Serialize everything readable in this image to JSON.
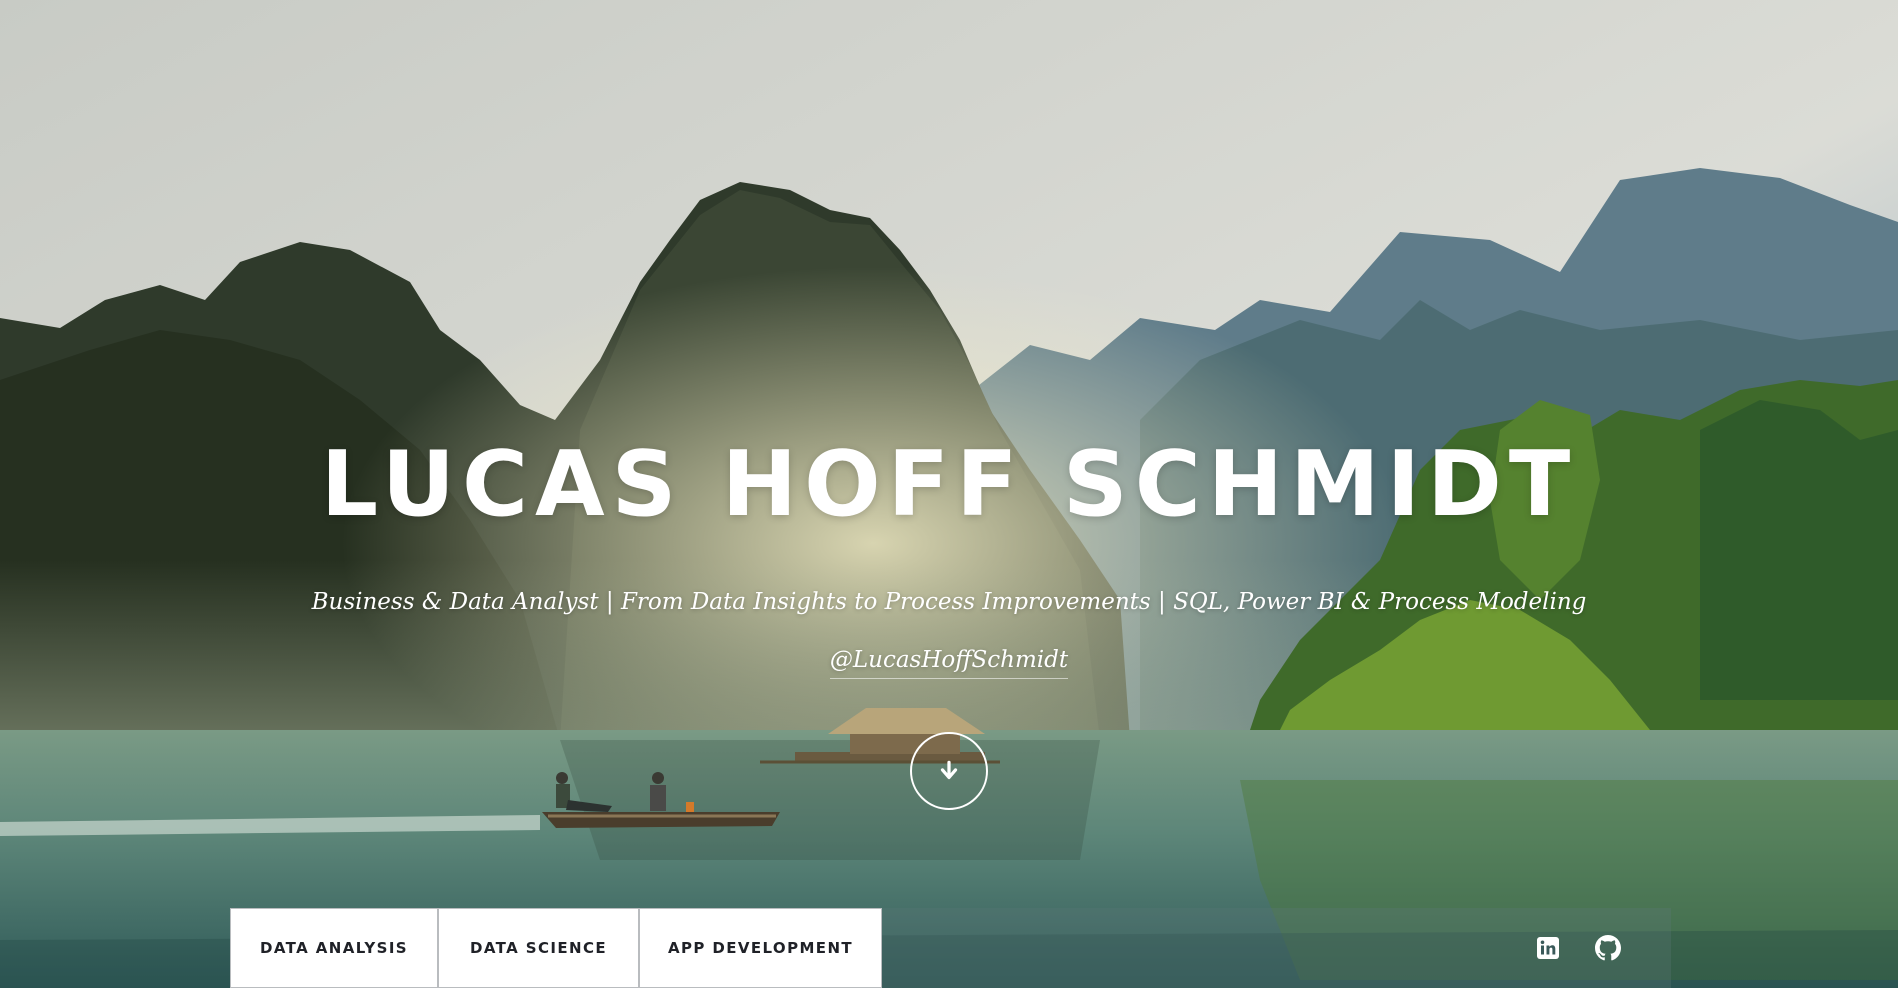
{
  "header": {
    "name": "LUCAS HOFF SCHMIDT",
    "tagline": "Business & Data Analyst | From Data Insights to Process Improvements | SQL, Power BI & Process Modeling",
    "handle": "@LucasHoffSchmidt"
  },
  "scroll": {
    "icon": "arrow-down-icon"
  },
  "tabs": [
    {
      "label": "DATA ANALYSIS"
    },
    {
      "label": "DATA SCIENCE"
    },
    {
      "label": "APP DEVELOPMENT"
    }
  ],
  "social": [
    {
      "icon": "linkedin-icon"
    },
    {
      "icon": "github-icon"
    }
  ],
  "colors": {
    "text": "#ffffff",
    "tab_background": "#ffffff",
    "tab_text": "#1f2127"
  }
}
